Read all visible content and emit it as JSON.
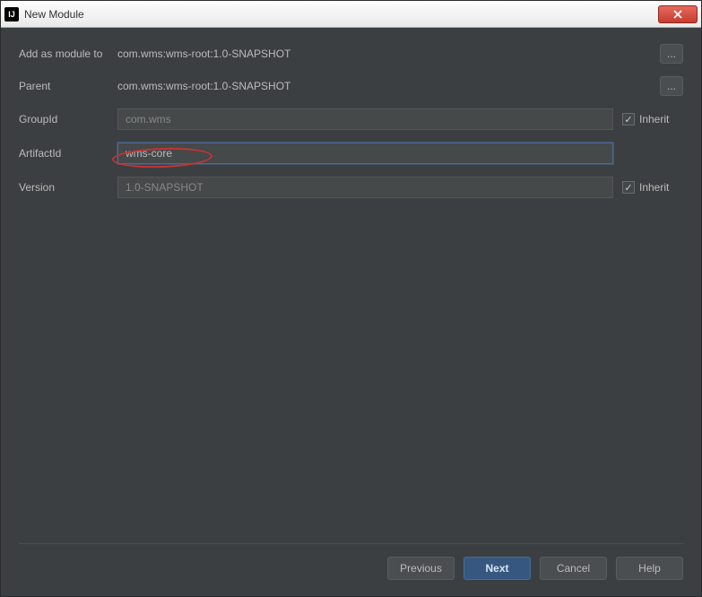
{
  "window": {
    "title": "New Module"
  },
  "form": {
    "addAsModuleTo": {
      "label": "Add as module to",
      "value": "com.wms:wms-root:1.0-SNAPSHOT"
    },
    "parent": {
      "label": "Parent",
      "value": "com.wms:wms-root:1.0-SNAPSHOT"
    },
    "groupId": {
      "label": "GroupId",
      "value": "com.wms",
      "inherit": {
        "label": "Inherit",
        "checked": true
      }
    },
    "artifactId": {
      "label": "ArtifactId",
      "value": "wms-core"
    },
    "version": {
      "label": "Version",
      "value": "1.0-SNAPSHOT",
      "inherit": {
        "label": "Inherit",
        "checked": true
      }
    }
  },
  "buttons": {
    "previous": "Previous",
    "next": "Next",
    "cancel": "Cancel",
    "help": "Help"
  },
  "dots": "..."
}
